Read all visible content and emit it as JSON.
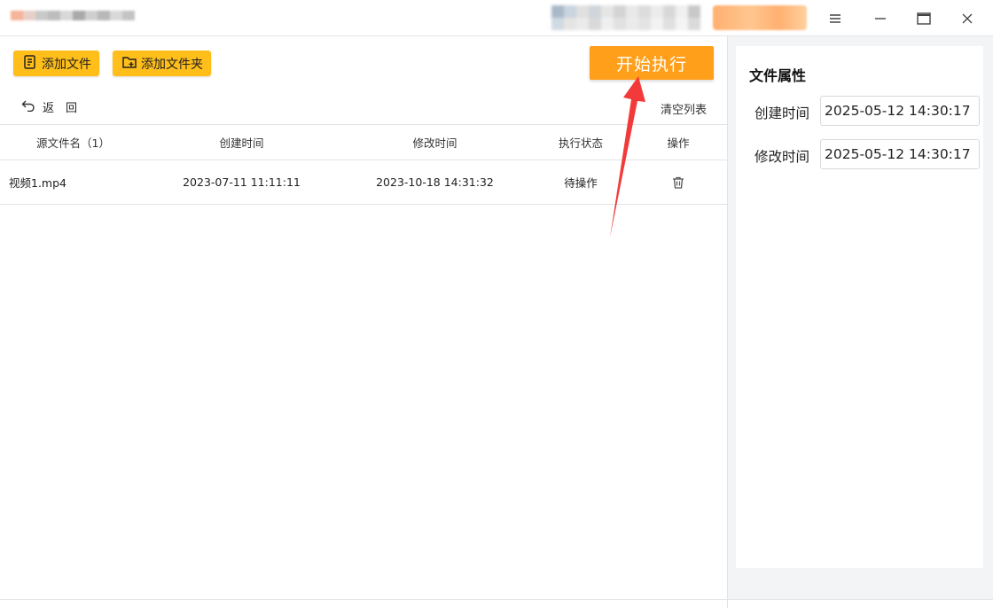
{
  "toolbar": {
    "add_file_label": "添加文件",
    "add_folder_label": "添加文件夹",
    "start_label": "开始执行",
    "back_label": "返　回",
    "clear_list_label": "清空列表"
  },
  "table": {
    "columns": [
      "源文件名（1）",
      "创建时间",
      "修改时间",
      "执行状态",
      "操作"
    ],
    "rows": [
      {
        "filename": "视频1.mp4",
        "created": "2023-07-11 11:11:11",
        "modified": "2023-10-18 14:31:32",
        "status": "待操作",
        "action_icon": "trash-icon"
      }
    ]
  },
  "properties": {
    "title": "文件属性",
    "created_label": "创建时间",
    "created_value": "2025-05-12 14:30:17",
    "modified_label": "修改时间",
    "modified_value": "2025-05-12 14:30:17"
  },
  "window": {
    "menu_icon": "menu-icon",
    "minimize_icon": "minimize-icon",
    "maximize_icon": "maximize-icon",
    "close_icon": "close-icon"
  },
  "colors": {
    "button_yellow": "#ffbe1a",
    "start_orange": "#ff9f1a",
    "arrow_red": "#f23a3a",
    "panel_bg": "#f3f4f6"
  }
}
